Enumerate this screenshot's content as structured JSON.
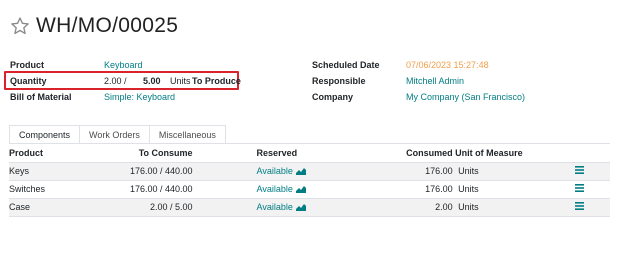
{
  "record": {
    "title": "WH/MO/00025"
  },
  "left_fields": {
    "product_label": "Product",
    "product_value": "Keyboard",
    "quantity_label": "Quantity",
    "quantity_produced": "2.00",
    "quantity_sep": "/",
    "quantity_total": "5.00",
    "quantity_unit": "Units",
    "quantity_suffix": "To Produce",
    "bom_label": "Bill of Material",
    "bom_value": "Simple: Keyboard"
  },
  "right_fields": {
    "scheduled_label": "Scheduled Date",
    "scheduled_value": "07/06/2023 15:27:48",
    "responsible_label": "Responsible",
    "responsible_value": "Mitchell Admin",
    "company_label": "Company",
    "company_value": "My Company (San Francisco)"
  },
  "tabs": [
    {
      "label": "Components"
    },
    {
      "label": "Work Orders"
    },
    {
      "label": "Miscellaneous"
    }
  ],
  "table": {
    "headers": {
      "product": "Product",
      "to_consume": "To Consume",
      "reserved": "Reserved",
      "consumed": "Consumed",
      "uom": "Unit of Measure"
    },
    "rows": [
      {
        "product": "Keys",
        "to_consume": "176.00 / 440.00",
        "reserved": "Available",
        "consumed": "176.00",
        "uom": "Units"
      },
      {
        "product": "Switches",
        "to_consume": "176.00 / 440.00",
        "reserved": "Available",
        "consumed": "176.00",
        "uom": "Units"
      },
      {
        "product": "Case",
        "to_consume": "2.00 / 5.00",
        "reserved": "Available",
        "consumed": "2.00",
        "uom": "Units"
      }
    ]
  },
  "colors": {
    "accent": "#017e84",
    "date": "#f0a04b",
    "highlight": "#d9222a"
  },
  "icons": {
    "favorite": "star-icon",
    "forecast": "area-chart-icon",
    "details": "list-icon"
  }
}
